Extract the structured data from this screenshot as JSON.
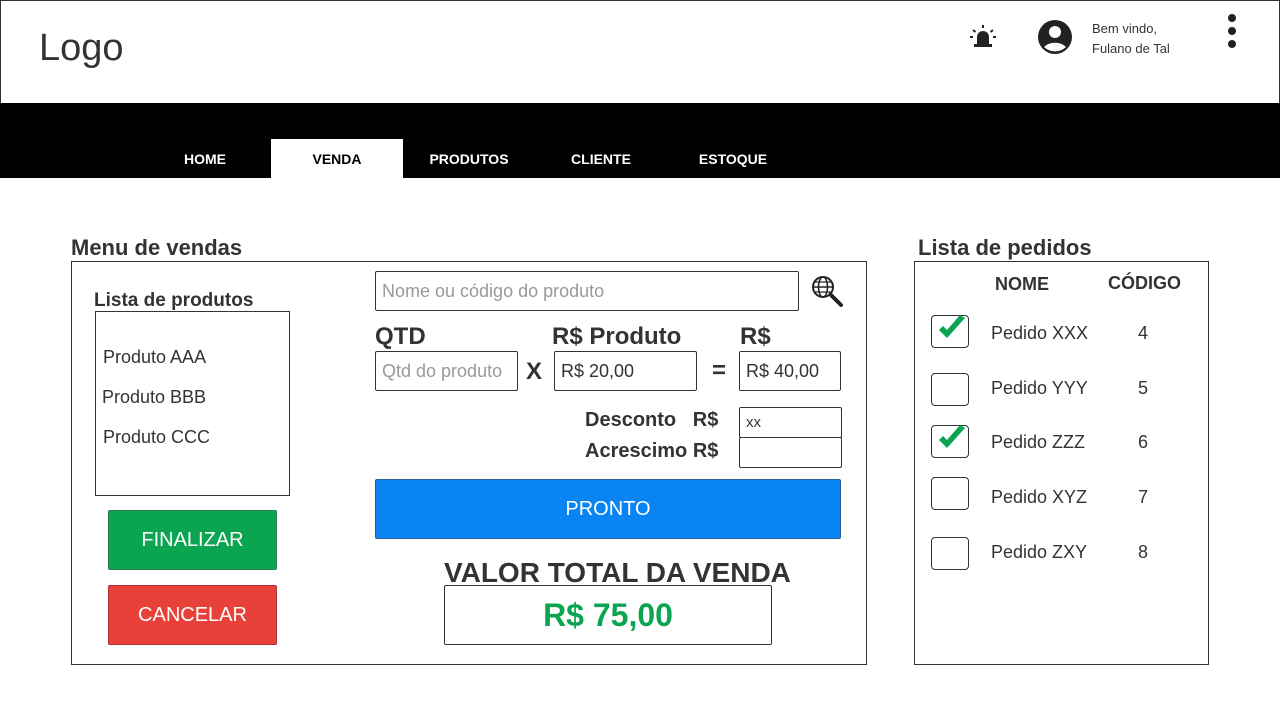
{
  "header": {
    "logo": "Logo",
    "welcome_line1": "Bem vindo,",
    "welcome_line2": "Fulano de Tal"
  },
  "nav": {
    "tabs": [
      {
        "label": "HOME",
        "active": false
      },
      {
        "label": "VENDA",
        "active": true
      },
      {
        "label": "PRODUTOS",
        "active": false
      },
      {
        "label": "CLIENTE",
        "active": false
      },
      {
        "label": "ESTOQUE",
        "active": false
      }
    ]
  },
  "sales": {
    "title": "Menu de vendas",
    "products_title": "Lista de produtos",
    "products": [
      "Produto AAA",
      "Produto BBB",
      "Produto CCC"
    ],
    "finalize_label": "FINALIZAR",
    "cancel_label": "CANCELAR",
    "search_placeholder": "Nome ou código do produto",
    "qty_label": "QTD",
    "qty_placeholder": "Qtd do produto",
    "times": "X",
    "price_label": "R$ Produto",
    "price_value": "R$ 20,00",
    "equals": "=",
    "subtotal_label": "R$",
    "subtotal_value": "R$ 40,00",
    "discount_label": "Desconto   R$",
    "discount_value": "xx",
    "surcharge_label": "Acrescimo R$",
    "surcharge_value": "",
    "ready_label": "PRONTO",
    "total_label": "VALOR TOTAL DA VENDA",
    "total_value": "R$ 75,00"
  },
  "orders": {
    "title": "Lista de pedidos",
    "col_name": "NOME",
    "col_code": "CÓDIGO",
    "items": [
      {
        "name": "Pedido XXX",
        "code": "4",
        "checked": true
      },
      {
        "name": "Pedido YYY",
        "code": "5",
        "checked": false
      },
      {
        "name": "Pedido ZZZ",
        "code": "6",
        "checked": true
      },
      {
        "name": "Pedido XYZ",
        "code": "7",
        "checked": false
      },
      {
        "name": "Pedido ZXY",
        "code": "8",
        "checked": false
      }
    ]
  },
  "colors": {
    "finalize": "#0ba552",
    "cancel": "#e8413a",
    "ready": "#0a84f3",
    "total": "#0ba552",
    "check": "#0ba552"
  }
}
